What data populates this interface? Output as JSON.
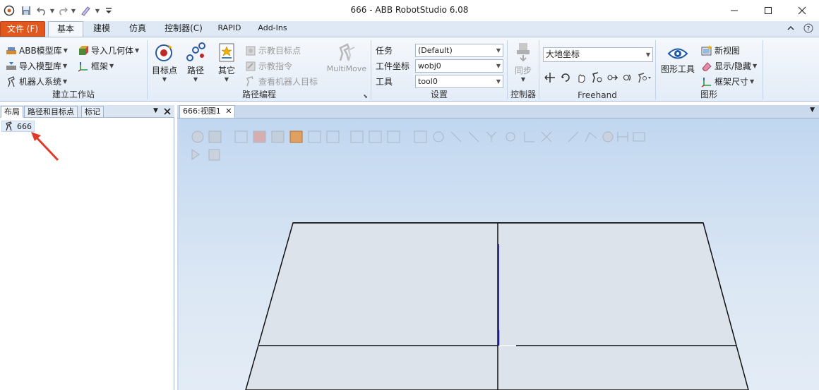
{
  "window": {
    "title": "666 - ABB RobotStudio 6.08",
    "minimize_icon": "minimize-icon",
    "maximize_icon": "maximize-icon",
    "close_icon": "close-icon"
  },
  "tabs": {
    "file": "文件 (F)",
    "home": "基本",
    "modeling": "建模",
    "simulation": "仿真",
    "controller": "控制器(C)",
    "rapid": "RAPID",
    "addins": "Add-Ins"
  },
  "ribbon": {
    "build_station": {
      "label": "建立工作站",
      "abb_library": "ABB模型库",
      "import_library": "导入模型库",
      "robot_system": "机器人系统",
      "import_geometry": "导入几何体",
      "frame": "框架"
    },
    "path_programming": {
      "label": "路径编程",
      "target": "目标点",
      "path": "路径",
      "other": "其它",
      "teach_target": "示教目标点",
      "teach_instruction": "示教指令",
      "view_robot_target": "查看机器人目标",
      "multimove": "MultiMove"
    },
    "settings": {
      "label": "设置",
      "task_label": "任务",
      "task_value": "(Default)",
      "wobj_label": "工件坐标",
      "wobj_value": "wobj0",
      "tool_label": "工具",
      "tool_value": "tool0"
    },
    "controller": {
      "label": "控制器",
      "sync": "同步"
    },
    "freehand": {
      "label": "Freehand",
      "frame_value": "大地坐标"
    },
    "graphics": {
      "label": "图形",
      "graphics_tools": "图形工具",
      "new_view": "新视图",
      "show_hide": "显示/隐藏",
      "frame_size": "框架尺寸"
    }
  },
  "left_panel": {
    "tabs": [
      "布局",
      "路径和目标点",
      "标记"
    ],
    "tree_root": "666"
  },
  "viewport": {
    "tab_label": "666:视图1"
  },
  "colors": {
    "file_tab": "#e2571b",
    "ribbon_bg": "#e3ecf7",
    "annotation_arrow": "#e03a2a",
    "floor": "#dde3ea"
  }
}
